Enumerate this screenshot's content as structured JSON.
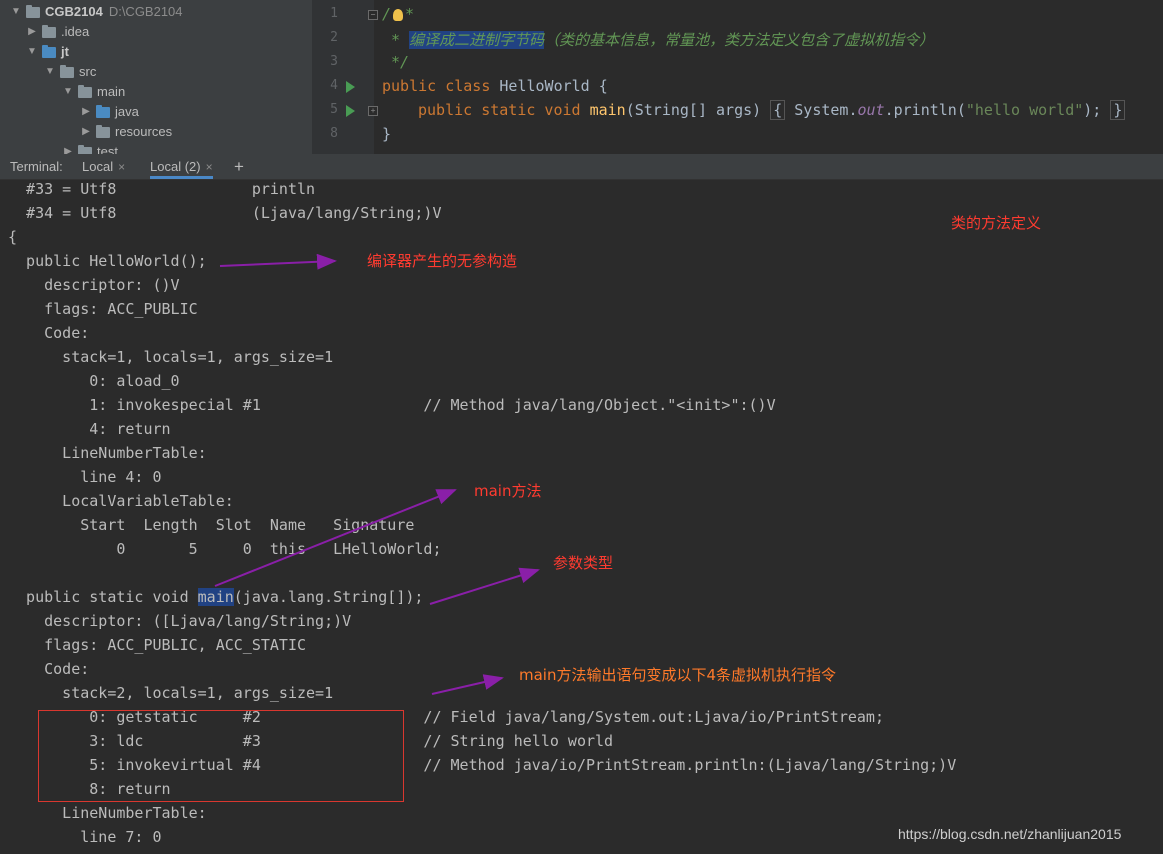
{
  "project_tree": {
    "project": {
      "name": "CGB2104",
      "path": "D:\\CGB2104"
    },
    "items": [
      {
        "label": ".idea"
      },
      {
        "label": "jt"
      },
      {
        "label": "src"
      },
      {
        "label": "main"
      },
      {
        "label": "java"
      },
      {
        "label": "resources"
      },
      {
        "label": "test"
      }
    ]
  },
  "editor": {
    "line_numbers": [
      "1",
      "2",
      "3",
      "4",
      "5",
      "8"
    ],
    "line1": {
      "open": "/",
      "star": "*"
    },
    "line2": {
      "prefix": " * ",
      "highlight": "编译成二进制字节码",
      "rest": "（类的基本信息，常量池，类方法定义包含了虚拟机指令）"
    },
    "line3": " */",
    "line4": {
      "kw": "public class ",
      "name": "HelloWorld {"
    },
    "line5": {
      "kw": "public static void ",
      "fn": "main",
      "sig": "(String[] args) ",
      "lb": "{",
      "sys": " System.",
      "out": "out",
      "call": ".println(",
      "str": "\"hello world\"",
      "end": ");",
      "rb": "}"
    },
    "line8": "}"
  },
  "terminal_tabs": {
    "label": "Terminal:",
    "tabs": [
      {
        "label": "Local"
      },
      {
        "label": "Local (2)"
      }
    ],
    "close": "×",
    "add": "+"
  },
  "terminal_lines": [
    "  #33 = Utf8               println",
    "  #34 = Utf8               (Ljava/lang/String;)V",
    "{",
    "  public HelloWorld();",
    "    descriptor: ()V",
    "    flags: ACC_PUBLIC",
    "    Code:",
    "      stack=1, locals=1, args_size=1",
    "         0: aload_0",
    "         1: invokespecial #1                  // Method java/lang/Object.\"<init>\":()V",
    "         4: return",
    "      LineNumberTable:",
    "        line 4: 0",
    "      LocalVariableTable:",
    "        Start  Length  Slot  Name   Signature",
    "            0       5     0  this   LHelloWorld;",
    "",
    "",
    "    descriptor: ([Ljava/lang/String;)V",
    "    flags: ACC_PUBLIC, ACC_STATIC",
    "    Code:",
    "      stack=2, locals=1, args_size=1",
    "         0: getstatic     #2                  // Field java/lang/System.out:Ljava/io/PrintStream;",
    "         3: ldc           #3                  // String hello world",
    "         5: invokevirtual #4                  // Method java/io/PrintStream.println:(Ljava/lang/String;)V",
    "         8: return",
    "      LineNumberTable:",
    "        line 7: 0"
  ],
  "main_signature": {
    "prefix": "  public static void ",
    "sel": "main",
    "suffix": "(java.lang.String[]);"
  },
  "annotations": {
    "class_methods": "类的方法定义",
    "constructor": "编译器产生的无参构造",
    "main_method": "main方法",
    "param_type": "参数类型",
    "instructions": "main方法输出语句变成以下4条虚拟机执行指令"
  },
  "watermark": "https://blog.csdn.net/zhanlijuan2015",
  "colors": {
    "annotation_red": "#ff3b30",
    "annotation_orange": "#ff7a2a",
    "arrow_purple": "#8a1fa8",
    "box_red": "#d9372f"
  }
}
